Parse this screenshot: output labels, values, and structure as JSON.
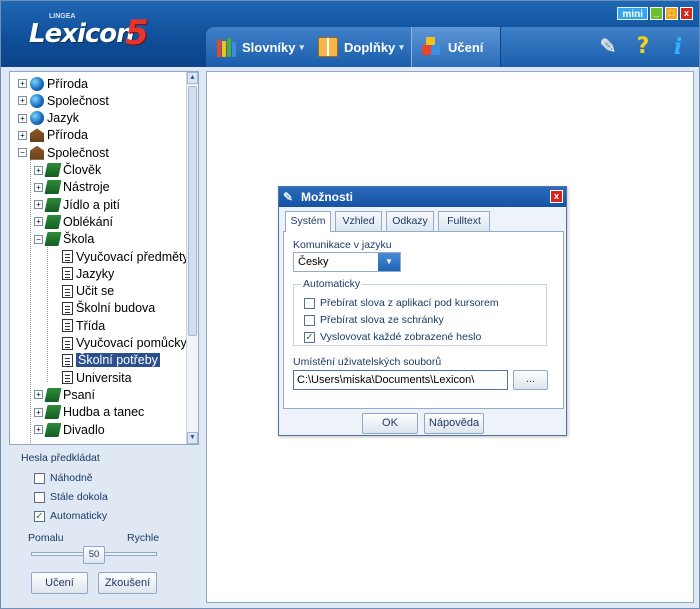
{
  "header": {
    "logo_small": "LINGEA",
    "logo_text": "Lexicon",
    "logo_version": "5",
    "tabs": [
      {
        "label": "Slovníky",
        "arrow": "▾"
      },
      {
        "label": "Doplňky",
        "arrow": "▾"
      },
      {
        "label": "Učení"
      }
    ],
    "icons": [
      "wrench-icon",
      "help-icon",
      "info-icon"
    ],
    "window_controls": {
      "mini_label": "mini",
      "minimize": "_",
      "maximize": "□",
      "close": "x"
    }
  },
  "tree": {
    "items": [
      {
        "label": "Příroda",
        "icon": "globe",
        "expander": "+"
      },
      {
        "label": "Společnost",
        "icon": "globe",
        "expander": "+"
      },
      {
        "label": "Jazyk",
        "icon": "globe",
        "expander": "+"
      },
      {
        "label": "Příroda",
        "icon": "museum",
        "expander": "+"
      },
      {
        "label": "Společnost",
        "icon": "museum",
        "expander": "−"
      },
      {
        "label": "Člověk",
        "icon": "book",
        "expander": "+"
      },
      {
        "label": "Nástroje",
        "icon": "book",
        "expander": "+"
      },
      {
        "label": "Jídlo a pití",
        "icon": "book",
        "expander": "+"
      },
      {
        "label": "Oblékání",
        "icon": "book",
        "expander": "+"
      },
      {
        "label": "Škola",
        "icon": "book",
        "expander": "−"
      },
      {
        "label": "Vyučovací předměty",
        "icon": "doc"
      },
      {
        "label": "Jazyky",
        "icon": "doc"
      },
      {
        "label": "Učit se",
        "icon": "doc"
      },
      {
        "label": "Školní budova",
        "icon": "doc"
      },
      {
        "label": "Třída",
        "icon": "doc"
      },
      {
        "label": "Vyučovací pomůcky",
        "icon": "doc"
      },
      {
        "label": "Školní potřeby",
        "icon": "doc",
        "selected": true
      },
      {
        "label": "Universita",
        "icon": "doc"
      },
      {
        "label": "Psaní",
        "icon": "book",
        "expander": "+"
      },
      {
        "label": "Hudba a tanec",
        "icon": "book",
        "expander": "+"
      },
      {
        "label": "Divadlo",
        "icon": "book",
        "expander": "+"
      }
    ],
    "scroll_up": "▲",
    "scroll_down": "▼"
  },
  "practice": {
    "title": "Hesla předkládat",
    "options": [
      {
        "label": "Náhodně",
        "checked": false
      },
      {
        "label": "Stále dokola",
        "checked": false
      },
      {
        "label": "Automaticky",
        "checked": true
      }
    ],
    "speed_slow": "Pomalu",
    "speed_fast": "Rychle",
    "speed_value": "50",
    "learn_button": "Učení",
    "test_button": "Zkoušení"
  },
  "dialog": {
    "title": "Možnosti",
    "close": "x",
    "tabs": [
      "Systém",
      "Vzhled",
      "Odkazy",
      "Fulltext"
    ],
    "active_tab": "Systém",
    "communication_label": "Komunikace v jazyku",
    "language_value": "Česky",
    "auto_title": "Automaticky",
    "auto_options": [
      {
        "label": "Přebírat slova z aplikací pod kursorem",
        "checked": false
      },
      {
        "label": "Přebírat slova ze schránky",
        "checked": false
      },
      {
        "label": "Vyslovovat každé zobrazené heslo",
        "checked": true
      }
    ],
    "path_label": "Umístění uživatelských souborů",
    "path_value": "C:\\Users\\miska\\Documents\\Lexicon\\",
    "browse_label": "...",
    "ok_label": "OK",
    "help_label": "Nápověda"
  },
  "colors": {
    "header": "#1452a3",
    "accent_red": "#d8261c",
    "selection": "#2b4f8c"
  }
}
